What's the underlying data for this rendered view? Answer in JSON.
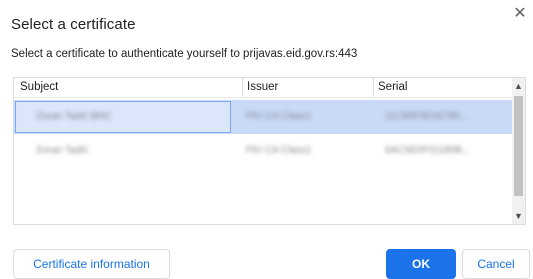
{
  "dialog": {
    "title": "Select a certificate",
    "subtitle": "Select a certificate to authenticate yourself to prijavas.eid.gov.rs:443",
    "close_icon": "close-icon"
  },
  "table": {
    "columns": [
      "Subject",
      "Issuer",
      "Serial"
    ],
    "rows": [
      {
        "subject": "Zoran Tadić BNC",
        "issuer": "PKI CA Class1",
        "serial": "11C80F9D32780...",
        "selected": true
      },
      {
        "subject": "Zoran Tadić",
        "issuer": "PKI CA Class1",
        "serial": "6AC5E0F01180B...",
        "selected": false
      }
    ]
  },
  "scrollbar": {
    "up_icon": "chevron-up-icon",
    "down_icon": "chevron-down-icon"
  },
  "buttons": {
    "info": "Certificate information",
    "ok": "OK",
    "cancel": "Cancel"
  },
  "colors": {
    "accent": "#1a73e8",
    "selected_row": "#c9daf8",
    "focus_border": "#7baaf7"
  }
}
